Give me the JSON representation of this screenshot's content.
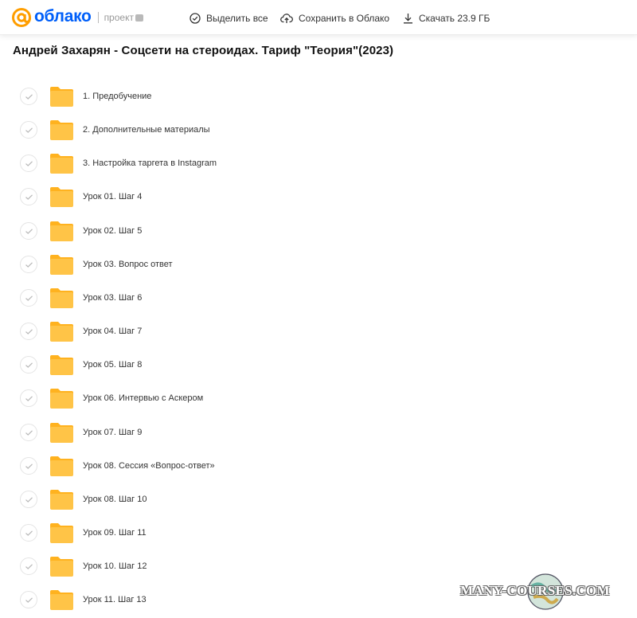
{
  "header": {
    "logo_text": "облако",
    "logo_sub": "проект",
    "actions": {
      "select_all": "Выделить все",
      "save_to_cloud": "Сохранить в Облако",
      "download": "Скачать 23.9 ГБ"
    }
  },
  "page_title": "Андрей Захарян - Соцсети на стероидах. Тариф \"Теория\"(2023)",
  "folders": [
    {
      "name": "1. Предобучение"
    },
    {
      "name": "2. Дополнительные материалы"
    },
    {
      "name": "3. Настройка таргета в Instagram"
    },
    {
      "name": "Урок 01. Шаг 4"
    },
    {
      "name": "Урок 02. Шаг 5"
    },
    {
      "name": "Урок 03. Вопрос ответ"
    },
    {
      "name": "Урок 03. Шаг 6"
    },
    {
      "name": "Урок 04. Шаг 7"
    },
    {
      "name": "Урок 05. Шаг 8"
    },
    {
      "name": "Урок 06. Интервью с Аскером"
    },
    {
      "name": "Урок 07. Шаг 9"
    },
    {
      "name": "Урок 08. Сессия «Вопрос-ответ»"
    },
    {
      "name": "Урок 08. Шаг 10"
    },
    {
      "name": "Урок 09. Шаг 11"
    },
    {
      "name": "Урок 10. Шаг 12"
    },
    {
      "name": "Урок 11. Шаг 13"
    }
  ],
  "watermark": "MANY-COURSES.COM",
  "colors": {
    "brand": "#005ff9",
    "folder": "#ffc447",
    "folder_back": "#ffb21f"
  }
}
